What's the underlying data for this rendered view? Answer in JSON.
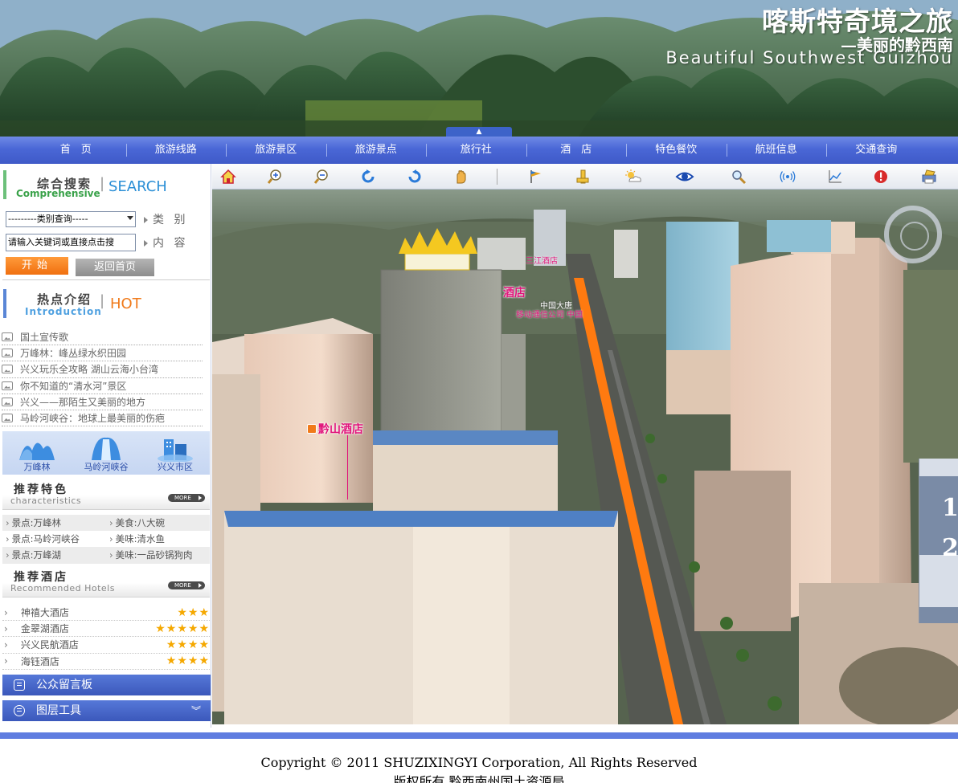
{
  "banner": {
    "title": "喀斯特奇境之旅",
    "subtitle": "—美丽的黔西南",
    "subtitle_en": "Beautiful Southwest Guizhou",
    "collapse_glyph": "▲"
  },
  "nav": {
    "items": [
      "首　页",
      "旅游线路",
      "旅游景区",
      "旅游景点",
      "旅行社",
      "酒　店",
      "特色餐饮",
      "航班信息",
      "交通查询"
    ]
  },
  "search": {
    "title_cn": "综合搜索",
    "title_en": "Comprehensive",
    "title_big": "SEARCH",
    "category_select": "---------类别查询-----",
    "category_label": "类 别",
    "keyword_value": "请输入关键词或直接点击搜",
    "keyword_label": "内 容",
    "start_button": "开始",
    "home_button": "返回首页"
  },
  "hot": {
    "title_cn": "热点介绍",
    "title_en": "Introduction",
    "title_big": "HOT",
    "items": [
      "国土宣传歌",
      "万峰林：峰丛绿水织田园",
      "兴义玩乐全攻略 湖山云海小台湾",
      "你不知道的“清水河”景区",
      "兴义——那陌生又美丽的地方",
      "马岭河峡谷：地球上最美丽的伤疤"
    ]
  },
  "spots": [
    "万峰林",
    "马岭河峡谷",
    "兴义市区"
  ],
  "features": {
    "title_cn": "推荐特色",
    "title_en": "characteristics",
    "more": "MORE",
    "rows": [
      [
        "景点:万峰林",
        "美食:八大碗"
      ],
      [
        "景点:马岭河峡谷",
        "美味:清水鱼"
      ],
      [
        "景点:万峰湖",
        "美味:一品砂锅狗肉"
      ]
    ]
  },
  "hotels": {
    "title_cn": "推荐酒店",
    "title_en": "Recommended Hotels",
    "more": "MORE",
    "items": [
      {
        "name": "神禧大酒店",
        "stars": "★★★"
      },
      {
        "name": "金翠湖酒店",
        "stars": "★★★★★"
      },
      {
        "name": "兴义民航酒店",
        "stars": "★★★★"
      },
      {
        "name": "海钰酒店",
        "stars": "★★★★"
      }
    ]
  },
  "panels": {
    "message_board": "公众留言板",
    "layer_tools": "图层工具",
    "layer_chevron": "︾"
  },
  "toolbar": {
    "icons": [
      "home-icon",
      "zoom-in-icon",
      "zoom-out-icon",
      "rotate-left-icon",
      "rotate-right-icon",
      "pan-hand-icon",
      "flag-icon",
      "measure-icon",
      "weather-icon",
      "eye-icon",
      "search-layer-icon",
      "signal-icon",
      "chart-icon",
      "alert-icon",
      "print-icon"
    ]
  },
  "map": {
    "poi_hotel": "黔山酒店",
    "poi_hotel2": "酒店",
    "poi_small1": "三江酒店",
    "poi_small2": "中国大唐",
    "poi_small3": "移动通信公司 中国",
    "side_num1": "1",
    "side_num2": "2"
  },
  "footer": {
    "copyright": "Copyright © 2011 SHUZIXINGYI Corporation, All Rights Reserved",
    "owner": "版权所有 黔西南州国土资源局"
  },
  "colors": {
    "nav_blue": "#4a67d6",
    "accent_orange": "#f07010",
    "star_gold": "#f5a800",
    "poi_pink": "#e0147a"
  }
}
